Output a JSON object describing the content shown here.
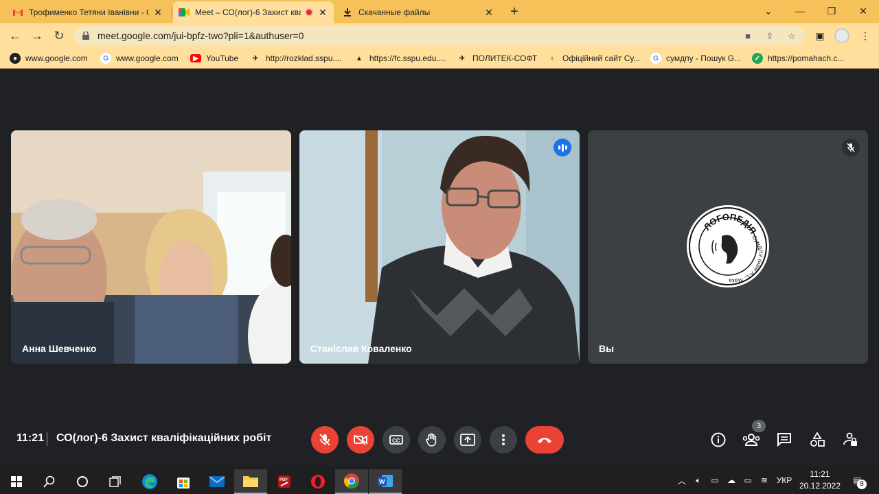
{
  "browser": {
    "tabs": [
      {
        "title": "Трофименко Тетяни Іванівни - С",
        "icon": "gmail-icon"
      },
      {
        "title": "Meet – СО(лог)-6 Захист ква",
        "icon": "meet-icon",
        "active": true,
        "recording_indicator": true
      },
      {
        "title": "Скачанные файлы",
        "icon": "download-icon"
      }
    ],
    "url": "meet.google.com/jui-bpfz-two?pli=1&authuser=0",
    "bookmarks": [
      {
        "label": "www.google.com",
        "icon": "github-icon"
      },
      {
        "label": "www.google.com",
        "icon": "google-icon"
      },
      {
        "label": "YouTube",
        "icon": "youtube-icon"
      },
      {
        "label": "http://rozklad.sspu....",
        "icon": "rocket-icon"
      },
      {
        "label": "https://fc.sspu.edu....",
        "icon": "graduation-cap-icon"
      },
      {
        "label": "ПОЛИТЕК-СОФТ",
        "icon": "rocket-icon"
      },
      {
        "label": "Офіційний сайт Су...",
        "icon": "crest-icon"
      },
      {
        "label": "сумдпу - Пошук G...",
        "icon": "google-icon"
      },
      {
        "label": "https://pomahach.c...",
        "icon": "check-icon"
      }
    ]
  },
  "meet": {
    "participants": [
      {
        "name": "Анна Шевченко"
      },
      {
        "name": "Станіслав Коваленко",
        "speaking": true
      },
      {
        "name": "Вы",
        "muted": true,
        "logo_text_top": "ЛОГОПЕДІЯ",
        "logo_text_side": "СумДПУ імені А.С. Макаренка"
      }
    ],
    "time": "11:21",
    "title": "СО(лог)-6 Захист кваліфікаційних робіт",
    "people_count": "3",
    "accent_red": "#ea4335",
    "accent_blue": "#8ab4f8"
  },
  "taskbar": {
    "time": "11:21",
    "date": "20.12.2022",
    "language": "УКР",
    "notifications": "8"
  }
}
